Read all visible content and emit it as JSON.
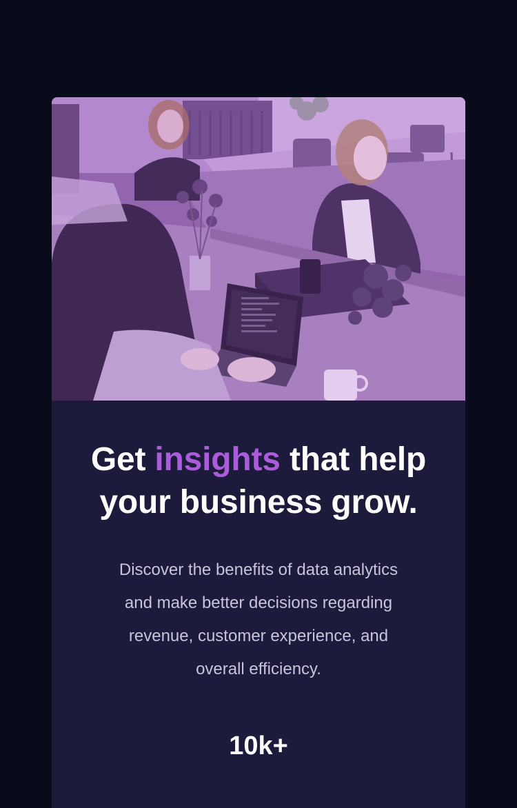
{
  "hero": {
    "image_alt": "Team of people working on laptops at shared office desks",
    "overlay_color": "#aa5ad2"
  },
  "headline": {
    "before": "Get ",
    "accent": "insights",
    "after": " that help your business grow."
  },
  "description": "Discover the benefits of data analytics and make better decisions regarding revenue, customer experience, and overall efficiency.",
  "stats": [
    {
      "value": "10k+"
    }
  ],
  "colors": {
    "page_background": "#0a0b1a",
    "card_background": "#1c1b3c",
    "accent": "#ab5cdb",
    "body_text": "#c8c4d9",
    "heading_text": "#ffffff"
  }
}
